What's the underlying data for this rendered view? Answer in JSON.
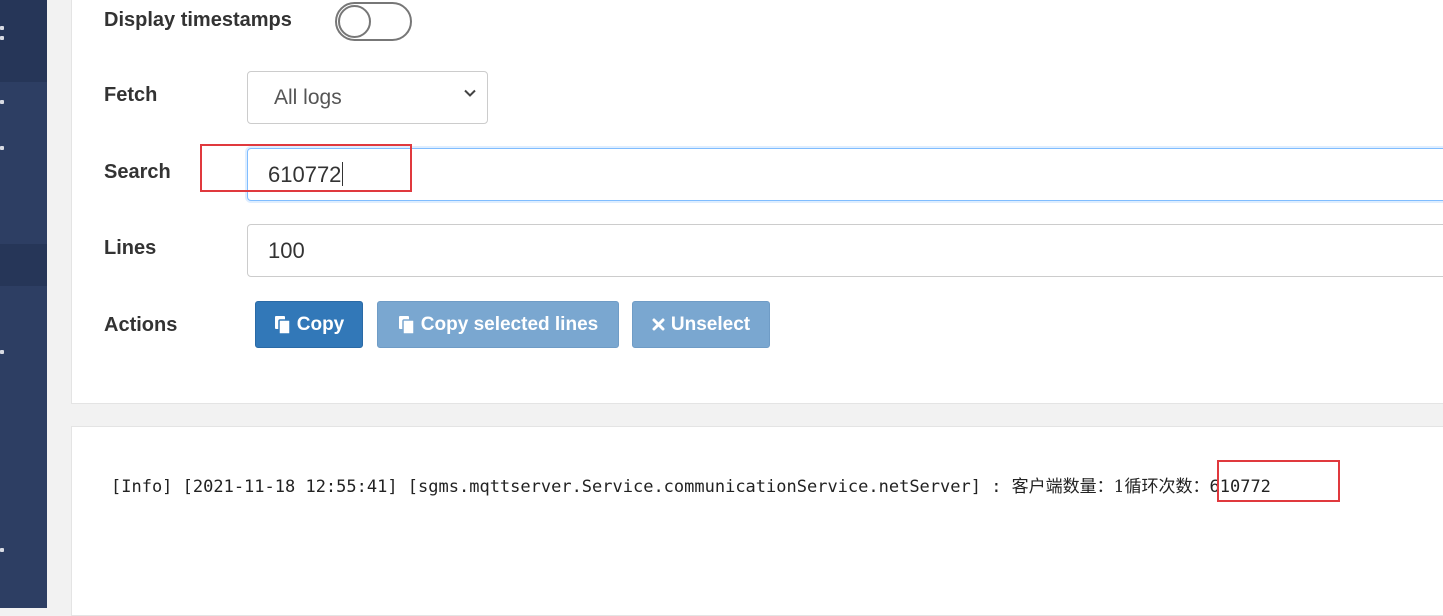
{
  "form": {
    "display_timestamps_label": "Display timestamps",
    "display_timestamps_on": false,
    "fetch_label": "Fetch",
    "fetch_value": "All logs",
    "search_label": "Search",
    "search_value": "610772",
    "lines_label": "Lines",
    "lines_value": "100",
    "actions_label": "Actions"
  },
  "actions": {
    "copy": "Copy",
    "copy_selected": "Copy selected lines",
    "unselect": "Unselect"
  },
  "log": {
    "prefix": "[Info] [2021-11-18 12:55:41] [sgms.mqttserver.Service.communicationService.netServer] : ",
    "message": "客户端数量：1循环次数：",
    "value": "610772"
  },
  "colors": {
    "sidebar": "#2d3e63",
    "primary": "#3278b8",
    "muted": "#7aa7d0",
    "highlight": "#e0393e"
  },
  "icons": {
    "copy": "copy-icon",
    "unselect": "x-icon",
    "dropdown": "chevron-down-icon"
  }
}
